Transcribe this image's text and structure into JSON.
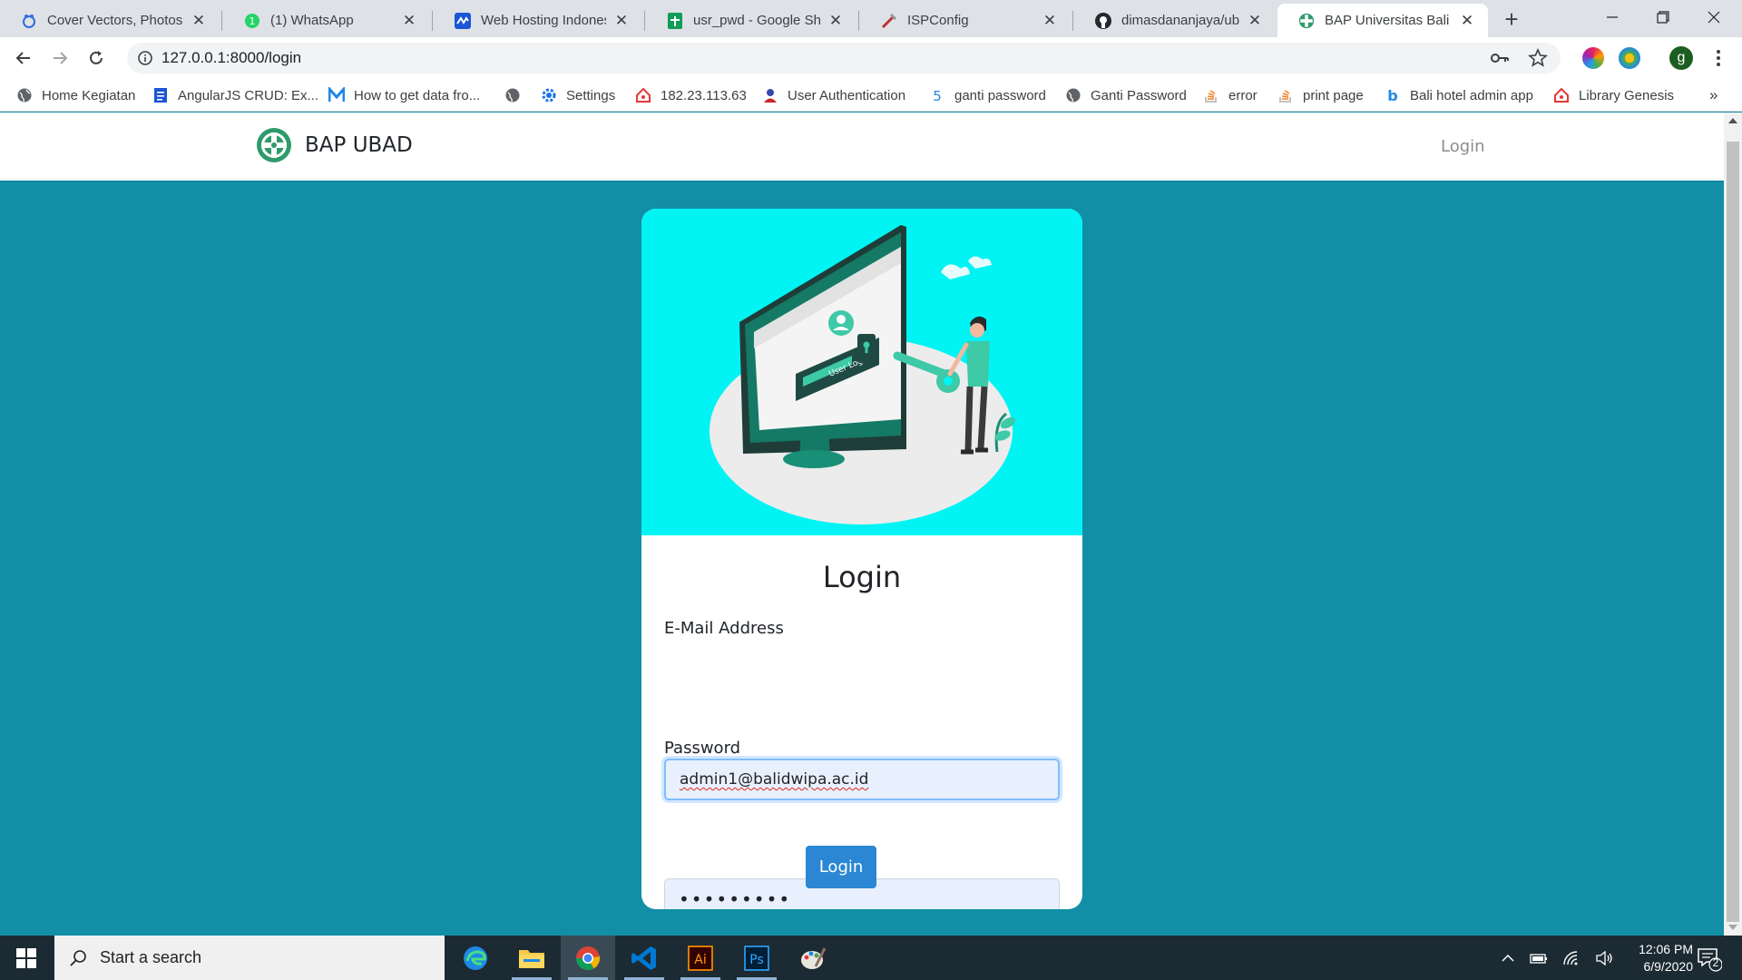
{
  "browser": {
    "tabs": [
      {
        "title": "Cover Vectors, Photos a",
        "icon": "freepik-icon"
      },
      {
        "title": "(1) WhatsApp",
        "icon": "whatsapp-icon"
      },
      {
        "title": "Web Hosting Indonesia",
        "icon": "web-hosting-icon"
      },
      {
        "title": "usr_pwd - Google Shee",
        "icon": "google-sheets-icon"
      },
      {
        "title": "ISPConfig",
        "icon": "ispconfig-icon"
      },
      {
        "title": "dimasdananjaya/ubad-",
        "icon": "github-icon"
      },
      {
        "title": "BAP Universitas Bali Dw",
        "icon": "bap-logo-icon",
        "active": true
      }
    ],
    "url": "127.0.0.1:8000/login",
    "profile_initial": "g",
    "bookmarks": [
      {
        "label": "Home Kegiatan",
        "icon": "globe-icon"
      },
      {
        "label": "AngularJS CRUD: Ex...",
        "icon": "document-icon"
      },
      {
        "label": "How to get data fro...",
        "icon": "medium-icon"
      },
      {
        "label": "",
        "icon": "globe-icon"
      },
      {
        "label": "Settings",
        "icon": "gear-icon"
      },
      {
        "label": "182.23.113.63",
        "icon": "home-icon"
      },
      {
        "label": "User Authentication",
        "icon": "user-auth-icon"
      },
      {
        "label": "ganti password",
        "icon": "five-icon"
      },
      {
        "label": "Ganti Password",
        "icon": "globe-icon"
      },
      {
        "label": "error",
        "icon": "stackoverflow-icon"
      },
      {
        "label": "print page",
        "icon": "stackoverflow-icon"
      },
      {
        "label": "Bali hotel admin app",
        "icon": "b-icon"
      },
      {
        "label": "Library Genesis",
        "icon": "home-icon"
      }
    ],
    "bookmarks_more": "»"
  },
  "site": {
    "brand": "BAP UBAD",
    "nav_login": "Login"
  },
  "login_card": {
    "title": "Login",
    "illustration_badge": "User Login",
    "email_label": "E-Mail Address",
    "email_value": "admin1@balidwipa.ac.id",
    "password_label": "Password",
    "password_value": "•••••••••",
    "submit_label": "Login"
  },
  "taskbar": {
    "search_placeholder": "Start a search",
    "apps": [
      "edge-icon",
      "file-explorer-icon",
      "chrome-icon",
      "vscode-icon",
      "illustrator-icon",
      "photoshop-icon",
      "paint-icon"
    ],
    "time": "12:06 PM",
    "date": "6/9/2020",
    "notification_count": "2"
  },
  "colors": {
    "page_bg": "#128ea6",
    "hero_bg": "#00f4f4",
    "accent": "#2b87d3",
    "brand_green": "#2e9b6b"
  }
}
